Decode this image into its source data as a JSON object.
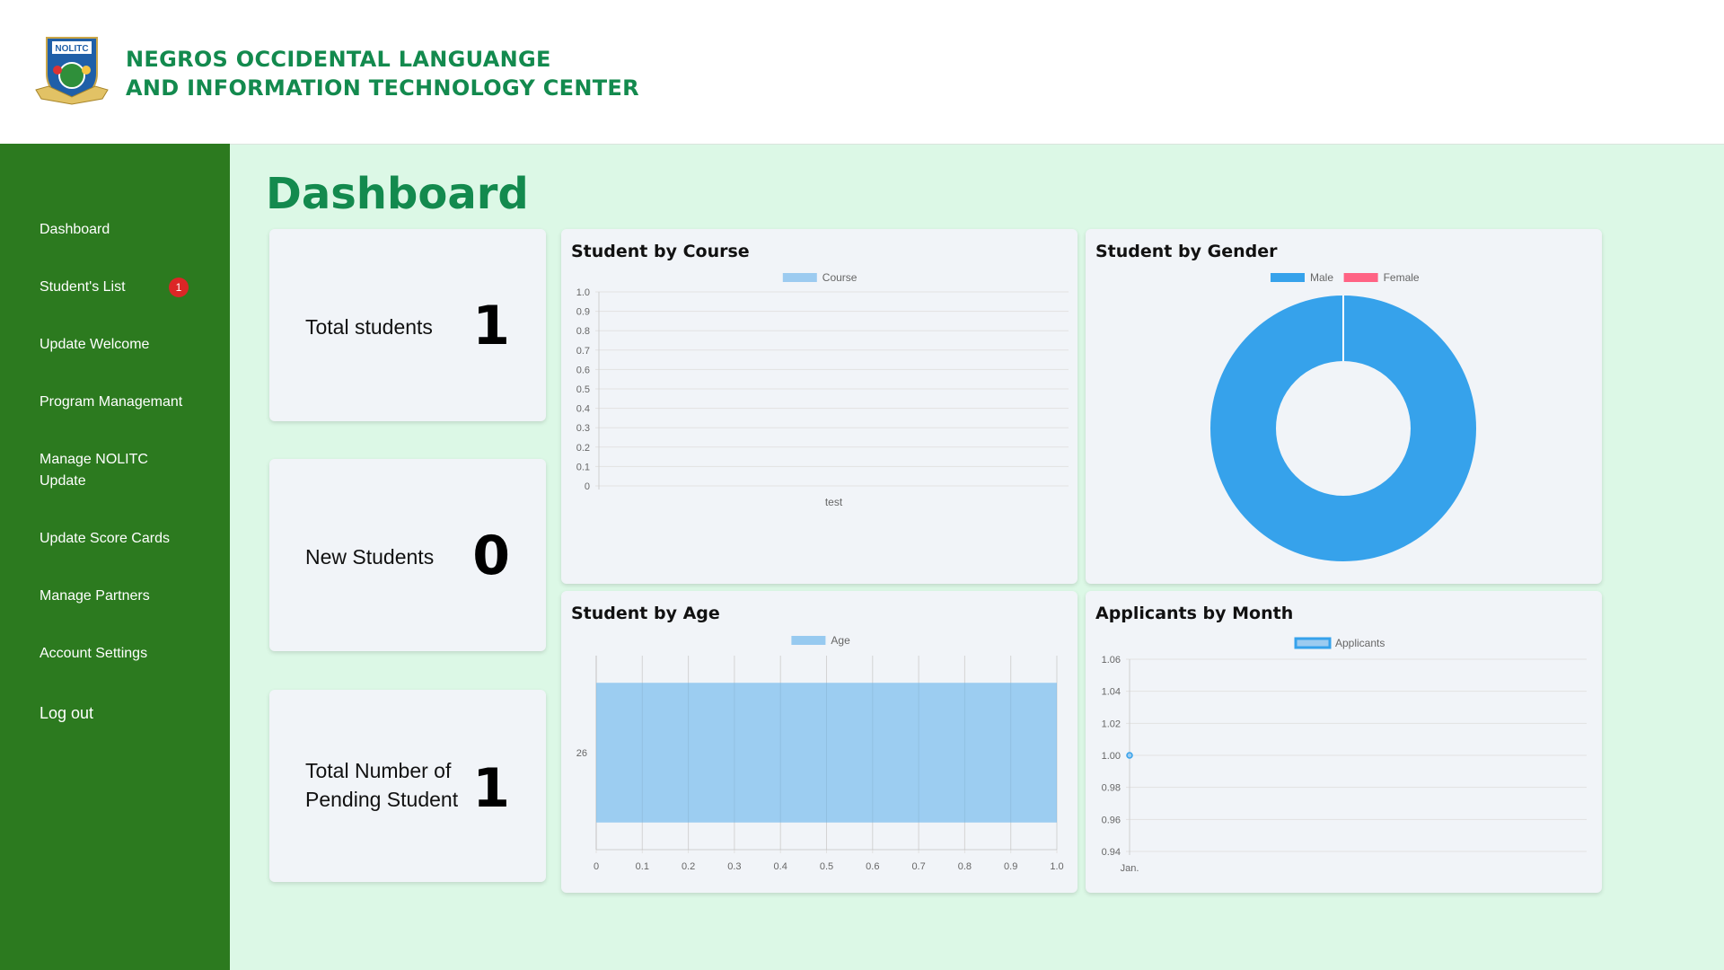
{
  "header": {
    "org_name_line1": "NEGROS OCCIDENTAL LANGUANGE",
    "org_name_line2": "AND INFORMATION TECHNOLOGY CENTER",
    "logo_text": "NOLITC"
  },
  "sidebar": {
    "items": [
      {
        "label": "Dashboard"
      },
      {
        "label": "Student's List",
        "badge": "1"
      },
      {
        "label": "Update Welcome"
      },
      {
        "label": "Program Managemant"
      },
      {
        "label": "Manage NOLITC Update"
      },
      {
        "label": "Update Score Cards"
      },
      {
        "label": "Manage Partners"
      },
      {
        "label": "Account Settings"
      },
      {
        "label": "Log out"
      }
    ]
  },
  "page": {
    "title": "Dashboard"
  },
  "stats": [
    {
      "label": "Total students",
      "value": "1"
    },
    {
      "label": "New Students",
      "value": "0"
    },
    {
      "label": "Total Number of Pending Student",
      "value": "1"
    }
  ],
  "chart_data": [
    {
      "id": "course",
      "type": "bar",
      "title": "Student by Course",
      "categories": [
        "test"
      ],
      "series": [
        {
          "name": "Course",
          "values": [
            0
          ]
        }
      ],
      "ylim": [
        0,
        1.0
      ],
      "yticks": [
        "1.0",
        "0.9",
        "0.8",
        "0.7",
        "0.6",
        "0.5",
        "0.4",
        "0.3",
        "0.2",
        "0.1",
        "0"
      ],
      "legend": "top",
      "grid": true,
      "color": "#9ccbf0"
    },
    {
      "id": "gender",
      "type": "pie",
      "title": "Student by Gender",
      "categories": [
        "Male",
        "Female"
      ],
      "values": [
        1,
        0
      ],
      "colors": [
        "#36a2eb",
        "#ff6384"
      ],
      "legend": "top"
    },
    {
      "id": "age",
      "type": "bar",
      "title": "Student by Age",
      "orientation": "horizontal",
      "categories": [
        "26"
      ],
      "series": [
        {
          "name": "Age",
          "values": [
            1.0
          ]
        }
      ],
      "xlim": [
        0,
        1.0
      ],
      "xticks": [
        "0",
        "0.1",
        "0.2",
        "0.3",
        "0.4",
        "0.5",
        "0.6",
        "0.7",
        "0.8",
        "0.9",
        "1.0"
      ],
      "legend": "top",
      "grid": true,
      "color": "#97caf0"
    },
    {
      "id": "applicants",
      "type": "line",
      "title": "Applicants by Month",
      "categories": [
        "Jan."
      ],
      "series": [
        {
          "name": "Applicants",
          "values": [
            1
          ]
        }
      ],
      "ylim": [
        0.94,
        1.06
      ],
      "yticks": [
        "1.06",
        "1.04",
        "1.02",
        "1.00",
        "0.98",
        "0.96",
        "0.94"
      ],
      "legend": "top",
      "grid": true,
      "color": "#36a2eb"
    }
  ]
}
